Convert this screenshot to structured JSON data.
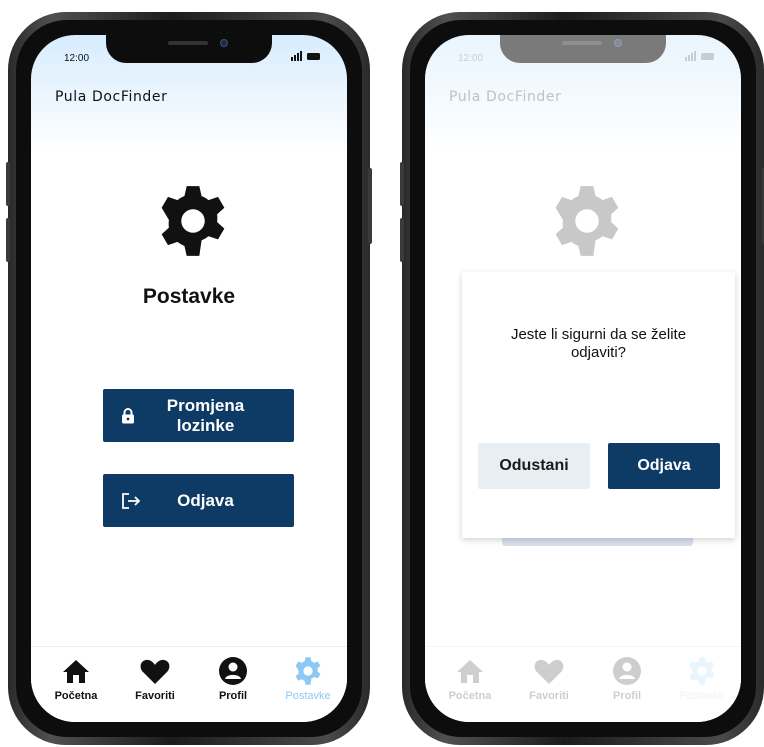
{
  "status": {
    "time": "12:00"
  },
  "app": {
    "title": "Pula DocFinder"
  },
  "settings": {
    "title": "Postavke",
    "change_password": {
      "label_line1": "Promjena",
      "label_line2": "lozinke",
      "icon": "lock-icon"
    },
    "logout": {
      "label": "Odjava",
      "icon": "logout-icon"
    }
  },
  "tabs": [
    {
      "label": "Početna",
      "icon": "home-icon",
      "active": false
    },
    {
      "label": "Favoriti",
      "icon": "heart-icon",
      "active": false
    },
    {
      "label": "Profil",
      "icon": "user-icon",
      "active": false
    },
    {
      "label": "Postavke",
      "icon": "gear-icon",
      "active": true
    }
  ],
  "dialog": {
    "message_line1": "Jeste li sigurni da se želite",
    "message_line2": "odjaviti?",
    "cancel_label": "Odustani",
    "confirm_label": "Odjava"
  },
  "colors": {
    "primary": "#0e3a66",
    "accent": "#8ec9f5",
    "cancel_bg": "#e8eef2"
  }
}
